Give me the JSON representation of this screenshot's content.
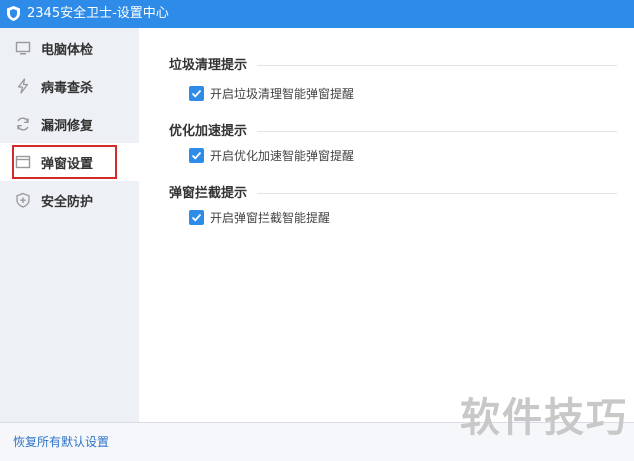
{
  "window": {
    "title": "2345安全卫士-设置中心"
  },
  "sidebar": {
    "items": [
      {
        "label": "电脑体检",
        "icon": "monitor-icon",
        "active": false
      },
      {
        "label": "病毒查杀",
        "icon": "lightning-icon",
        "active": false
      },
      {
        "label": "漏洞修复",
        "icon": "refresh-icon",
        "active": false
      },
      {
        "label": "弹窗设置",
        "icon": "window-icon",
        "active": true
      },
      {
        "label": "安全防护",
        "icon": "shield-plus-icon",
        "active": false
      }
    ]
  },
  "main": {
    "sections": [
      {
        "title": "垃圾清理提示",
        "option": {
          "label": "开启垃圾清理智能弹窗提醒",
          "checked": true
        }
      },
      {
        "title": "优化加速提示",
        "option": {
          "label": "开启优化加速智能弹窗提醒",
          "checked": true
        }
      },
      {
        "title": "弹窗拦截提示",
        "option": {
          "label": "开启弹窗拦截智能提醒",
          "checked": true
        }
      }
    ]
  },
  "footer": {
    "restore_label": "恢复所有默认设置"
  },
  "watermark": {
    "text": "软件技巧"
  },
  "colors": {
    "accent": "#2e8be8",
    "highlight_border": "#d12b2b",
    "sidebar_bg": "#edf0f4"
  }
}
